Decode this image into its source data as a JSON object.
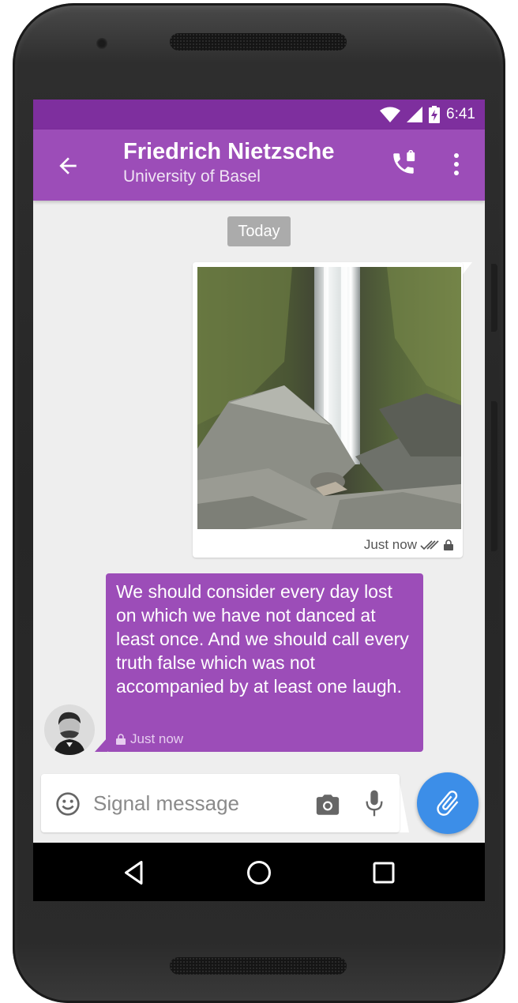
{
  "status_bar": {
    "time": "6:41"
  },
  "app_bar": {
    "title": "Friedrich Nietzsche",
    "subtitle": "University of Basel",
    "color": "#9c4db8",
    "status_color": "#7e2f9e"
  },
  "conversation": {
    "date_divider": "Today",
    "image_message": {
      "timestamp": "Just now"
    },
    "text_message": {
      "text": "We should consider every day lost on which we have not danced at least once. And we should call every truth false which was not accompanied by at least one laugh.",
      "timestamp": "Just now"
    }
  },
  "composer": {
    "placeholder": "Signal message",
    "attach_color": "#3c8ee8"
  },
  "icons": [
    "back-arrow-icon",
    "call-icon",
    "more-vert-icon",
    "emoji-icon",
    "camera-icon",
    "mic-icon",
    "attachment-icon",
    "lock-icon",
    "double-check-icon",
    "nav-back-icon",
    "nav-home-icon",
    "nav-recents-icon",
    "wifi-icon",
    "signal-icon",
    "battery-icon"
  ]
}
